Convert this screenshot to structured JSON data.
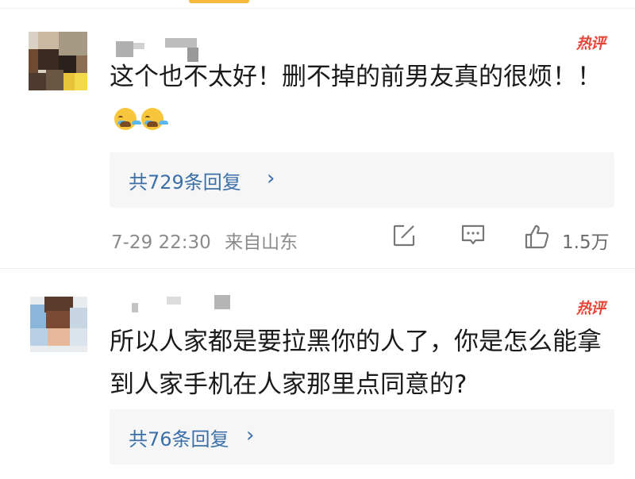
{
  "colors": {
    "hot": "#e9463a",
    "link": "#3b6fa8",
    "meta": "#8a8a8a",
    "reply_bg": "#f6f6f6"
  },
  "comments": [
    {
      "badge": "热评",
      "text": "这个也不太好！删不掉的前男友真的很烦！！",
      "emoji": [
        "crying-face",
        "crying-face"
      ],
      "replies_label": "共729条回复",
      "timestamp": "7-29 22:30",
      "location": "来自山东",
      "likes": "1.5万"
    },
    {
      "badge": "热评",
      "text": "所以人家都是要拉黑你的人了，你是怎么能拿到人家手机在人家那里点同意的?",
      "replies_label": "共76条回复"
    }
  ],
  "icons": [
    "chevron-right-icon",
    "share-edit-icon",
    "comment-icon",
    "thumbs-up-icon"
  ]
}
